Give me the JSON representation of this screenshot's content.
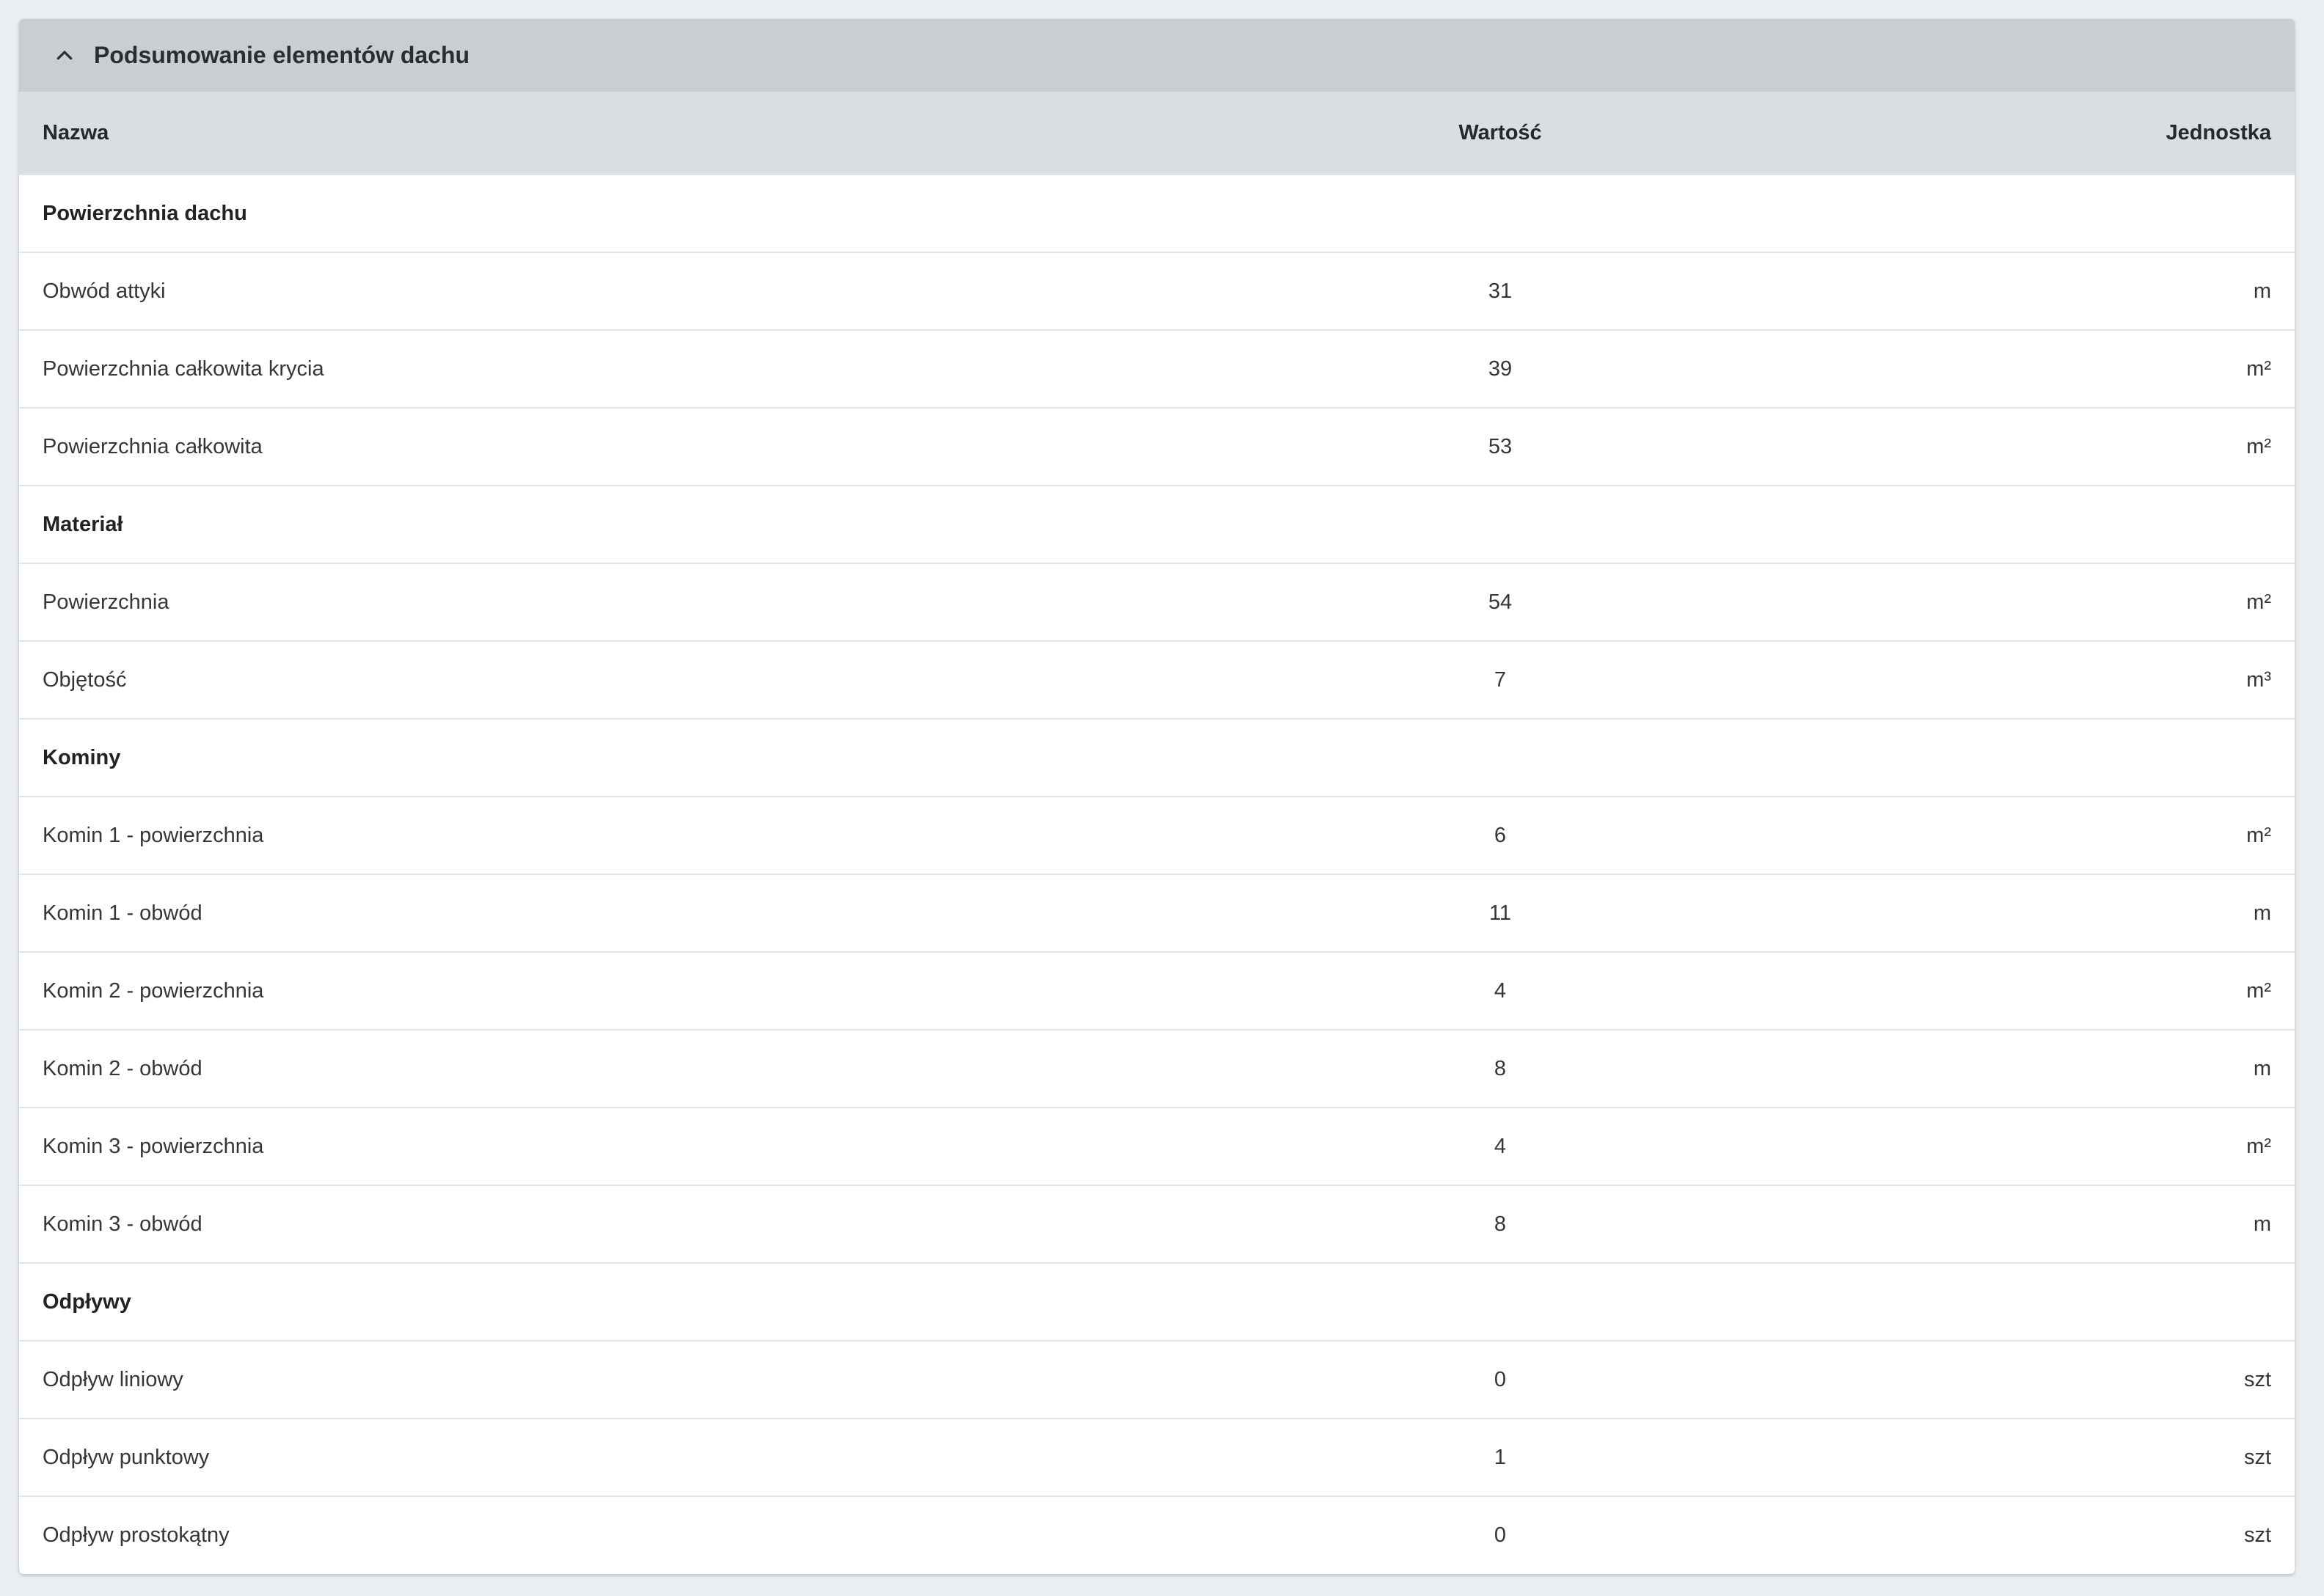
{
  "panel": {
    "title": "Podsumowanie elementów dachu",
    "toggle_icon": "chevron-up-icon"
  },
  "table": {
    "headers": [
      "Nazwa",
      "Wartość",
      "Jednostka"
    ],
    "rows": [
      {
        "name": "Powierzchnia dachu",
        "value": "",
        "unit": "",
        "group": true
      },
      {
        "name": "Obwód attyki",
        "value": "31",
        "unit": "m"
      },
      {
        "name": "Powierzchnia całkowita krycia",
        "value": "39",
        "unit": "m²"
      },
      {
        "name": "Powierzchnia całkowita",
        "value": "53",
        "unit": "m²"
      },
      {
        "name": "Materiał",
        "value": "",
        "unit": "",
        "group": true
      },
      {
        "name": "Powierzchnia",
        "value": "54",
        "unit": "m²"
      },
      {
        "name": "Objętość",
        "value": "7",
        "unit": "m³"
      },
      {
        "name": "Kominy",
        "value": "",
        "unit": "",
        "group": true
      },
      {
        "name": "Komin 1 - powierzchnia",
        "value": "6",
        "unit": "m²"
      },
      {
        "name": "Komin 1 - obwód",
        "value": "11",
        "unit": "m"
      },
      {
        "name": "Komin 2 - powierzchnia",
        "value": "4",
        "unit": "m²"
      },
      {
        "name": "Komin 2 - obwód",
        "value": "8",
        "unit": "m"
      },
      {
        "name": "Komin 3 - powierzchnia",
        "value": "4",
        "unit": "m²"
      },
      {
        "name": "Komin 3 - obwód",
        "value": "8",
        "unit": "m"
      },
      {
        "name": "Odpływy",
        "value": "",
        "unit": "",
        "group": true
      },
      {
        "name": "Odpływ liniowy",
        "value": "0",
        "unit": "szt"
      },
      {
        "name": "Odpływ punktowy",
        "value": "1",
        "unit": "szt"
      },
      {
        "name": "Odpływ prostokątny",
        "value": "0",
        "unit": "szt"
      }
    ]
  }
}
